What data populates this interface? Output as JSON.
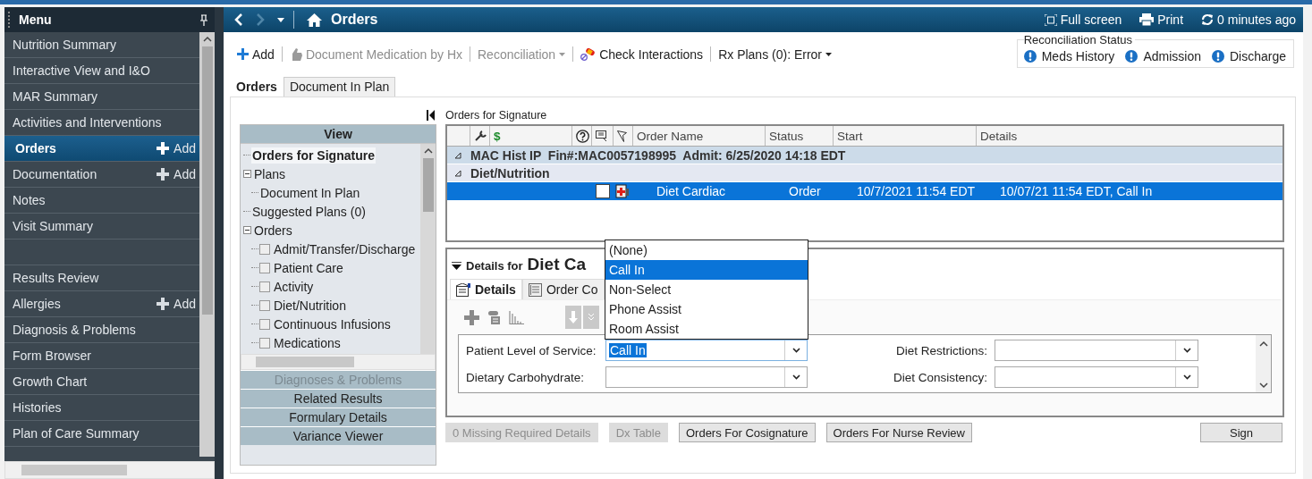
{
  "menu": {
    "title": "Menu",
    "groups": [
      [
        {
          "label": "Nutrition Summary",
          "selected": false
        },
        {
          "label": "Interactive View and I&O",
          "selected": false
        },
        {
          "label": "MAR Summary",
          "selected": false
        },
        {
          "label": "Activities and Interventions",
          "selected": false
        },
        {
          "label": "Orders",
          "selected": true,
          "action": "Add"
        },
        {
          "label": "Documentation",
          "selected": false,
          "action": "Add"
        },
        {
          "label": "Notes",
          "selected": false
        },
        {
          "label": "Visit Summary",
          "selected": false
        }
      ],
      [
        {
          "label": "Results Review",
          "selected": false
        },
        {
          "label": "Allergies",
          "selected": false,
          "action": "Add"
        },
        {
          "label": "Diagnosis & Problems",
          "selected": false
        },
        {
          "label": "Form Browser",
          "selected": false
        },
        {
          "label": "Growth Chart",
          "selected": false
        },
        {
          "label": "Histories",
          "selected": false
        },
        {
          "label": "Plan of Care Summary",
          "selected": false
        }
      ]
    ]
  },
  "header": {
    "title": "Orders",
    "forward_disabled": true,
    "actions": [
      {
        "kind": "fullscreen",
        "label": "Full screen"
      },
      {
        "kind": "print",
        "label": "Print"
      },
      {
        "kind": "refresh",
        "label": "0 minutes ago"
      }
    ]
  },
  "toolbar": [
    {
      "kind": "add",
      "label": "Add",
      "disabled": false,
      "has_menu": false
    },
    {
      "kind": "document",
      "label": "Document Medication by Hx",
      "disabled": true,
      "has_menu": false
    },
    {
      "kind": "plain",
      "label": "Reconciliation",
      "disabled": true,
      "has_menu": true
    },
    {
      "kind": "interactions",
      "label": "Check Interactions",
      "disabled": false,
      "has_menu": false
    },
    {
      "kind": "plain",
      "label": "Rx Plans (0): Error",
      "disabled": false,
      "has_menu": true
    }
  ],
  "reconciliation_status": {
    "title": "Reconciliation Status",
    "items": [
      "Meds History",
      "Admission",
      "Discharge"
    ]
  },
  "tabs": [
    {
      "label": "Orders",
      "selected": true
    },
    {
      "label": "Document In Plan",
      "selected": false
    }
  ],
  "view_panel": {
    "title": "View",
    "tree": [
      {
        "label": "Orders for Signature",
        "selected": true
      },
      {
        "label": "Plans",
        "selected": false,
        "expanded": true,
        "children": [
          {
            "label": "Document In Plan",
            "selected": false
          }
        ]
      },
      {
        "label": "Suggested Plans (0)",
        "selected": false
      },
      {
        "label": "Orders",
        "selected": false,
        "expanded": true,
        "children": [
          {
            "label": "Admit/Transfer/Discharge",
            "selected": false,
            "checked": false
          },
          {
            "label": "Patient Care",
            "selected": false,
            "checked": false
          },
          {
            "label": "Activity",
            "selected": false,
            "checked": false
          },
          {
            "label": "Diet/Nutrition",
            "selected": false,
            "checked": false
          },
          {
            "label": "Continuous Infusions",
            "selected": false,
            "checked": false
          },
          {
            "label": "Medications",
            "selected": false,
            "checked": false
          }
        ]
      }
    ],
    "sections": [
      {
        "label": "Diagnoses & Problems",
        "disabled": true
      },
      {
        "label": "Related Results",
        "disabled": false
      },
      {
        "label": "Formulary Details",
        "disabled": false
      },
      {
        "label": "Variance Viewer",
        "disabled": false
      }
    ]
  },
  "orders_table": {
    "caption": "Orders for Signature",
    "columns": [
      {
        "kind": "blank"
      },
      {
        "kind": "wrench-icon"
      },
      {
        "kind": "text",
        "label": "$"
      },
      {
        "kind": "help-icon"
      },
      {
        "kind": "comment-icon"
      },
      {
        "kind": "flag-icon"
      },
      {
        "kind": "text",
        "label": "Order Name"
      },
      {
        "kind": "text",
        "label": "Status"
      },
      {
        "kind": "text",
        "label": "Start"
      },
      {
        "kind": "text",
        "label": "Details"
      }
    ],
    "groups": [
      {
        "label": "MAC Hist IP  Fin#:MAC0057198995  Admit: 6/25/2020 14:18 EDT",
        "kind": "encounter"
      },
      {
        "label": "Diet/Nutrition",
        "kind": "category"
      }
    ],
    "rows": [
      {
        "selected": true,
        "checked": false,
        "order_name": "Diet Cardiac",
        "status": "Order",
        "start": "10/7/2021 11:54 EDT",
        "details": "10/07/21 11:54 EDT, Call In"
      }
    ]
  },
  "details": {
    "prefix": "Details for",
    "title": "Diet Ca",
    "tabs": [
      {
        "label": "Details",
        "selected": true
      },
      {
        "label": "Order Co",
        "selected": false
      }
    ],
    "fields": [
      {
        "label": "Patient Level of Service:",
        "value": "Call In",
        "open": true,
        "options": [
          {
            "label": "(None)",
            "selected": false
          },
          {
            "label": "Call In",
            "selected": true
          },
          {
            "label": "Non-Select",
            "selected": false
          },
          {
            "label": "Phone Assist",
            "selected": false
          },
          {
            "label": "Room Assist",
            "selected": false
          }
        ]
      },
      {
        "label": "Diet Restrictions:",
        "open": false
      },
      {
        "label": "Dietary Carbohydrate:",
        "open": false
      },
      {
        "label": "Diet Consistency:",
        "open": false
      }
    ]
  },
  "footer_buttons": [
    {
      "label": "0 Missing Required Details",
      "disabled": true
    },
    {
      "label": "Dx Table",
      "disabled": true
    },
    {
      "label": "Orders For Cosignature",
      "disabled": false
    },
    {
      "label": "Orders For Nurse Review",
      "disabled": false
    }
  ],
  "sign_button": {
    "label": "Sign",
    "disabled": false
  }
}
